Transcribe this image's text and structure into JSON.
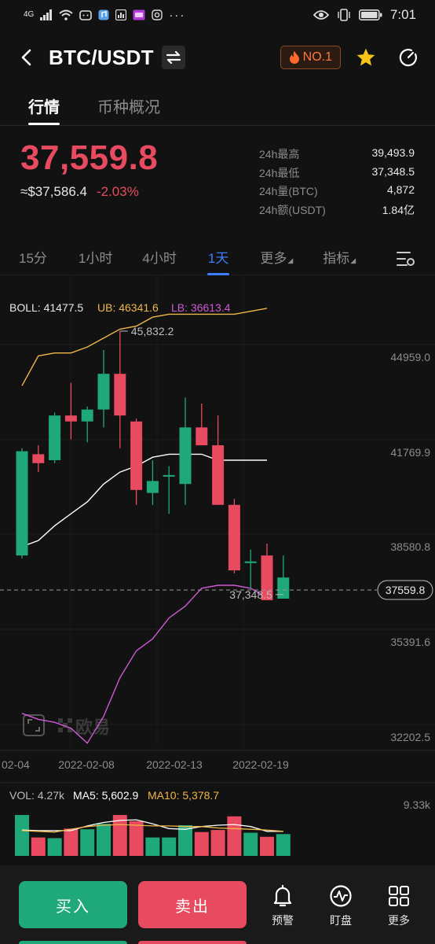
{
  "status_bar": {
    "network": "4G",
    "time": "7:01"
  },
  "header": {
    "pair": "BTC/USDT",
    "rank": "NO.1"
  },
  "tabs": [
    {
      "label": "行情",
      "active": true
    },
    {
      "label": "币种概况",
      "active": false
    }
  ],
  "price": {
    "last": "37,559.8",
    "usd": "≈$37,586.4",
    "change": "-2.03%"
  },
  "stats": [
    {
      "label": "24h最高",
      "value": "39,493.9"
    },
    {
      "label": "24h最低",
      "value": "37,348.5"
    },
    {
      "label": "24h量(BTC)",
      "value": "4,872"
    },
    {
      "label": "24h额(USDT)",
      "value": "1.84亿"
    }
  ],
  "intervals": [
    {
      "label": "15分",
      "active": false
    },
    {
      "label": "1小时",
      "active": false
    },
    {
      "label": "4小时",
      "active": false
    },
    {
      "label": "1天",
      "active": true
    },
    {
      "label": "更多",
      "active": false
    },
    {
      "label": "指标",
      "active": false
    }
  ],
  "indicators": {
    "boll": {
      "label": "BOLL: 41477.5",
      "ub": "UB: 46341.6",
      "lb": "LB: 36613.4"
    },
    "vol": {
      "label": "VOL: 4.27k",
      "ma5": "MA5: 5,602.9",
      "ma10": "MA10: 5,378.7"
    }
  },
  "watermark": "欧易",
  "colors": {
    "up": "#1fa97b",
    "down": "#e84a5f",
    "ub": "#f0b64a",
    "lb": "#d05ad6",
    "mid": "#ffffff",
    "accent": "#3d7eff",
    "rank": "#ff7a3a"
  },
  "chart_data": {
    "type": "candlestick",
    "y_axis_ticks": [
      "44959.0",
      "41769.9",
      "38580.8",
      "35391.6",
      "32202.5"
    ],
    "x_axis_ticks": [
      "02-04",
      "2022-02-08",
      "2022-02-13",
      "2022-02-19"
    ],
    "annotations": {
      "high": "45,832.2",
      "low": "37,348.5",
      "current": "37559.8"
    },
    "volume_axis_max_label": "9.33k",
    "candles": [
      {
        "o": 38300,
        "h": 41900,
        "l": 38200,
        "c": 41800
      },
      {
        "o": 41700,
        "h": 42000,
        "l": 41100,
        "c": 41400
      },
      {
        "o": 41500,
        "h": 43100,
        "l": 41400,
        "c": 43000
      },
      {
        "o": 43000,
        "h": 44100,
        "l": 42200,
        "c": 42800
      },
      {
        "o": 42800,
        "h": 43300,
        "l": 42100,
        "c": 43200
      },
      {
        "o": 43200,
        "h": 45200,
        "l": 42600,
        "c": 44400
      },
      {
        "o": 44400,
        "h": 45832.2,
        "l": 41900,
        "c": 43000
      },
      {
        "o": 42800,
        "h": 42900,
        "l": 40000,
        "c": 40500
      },
      {
        "o": 40400,
        "h": 41500,
        "l": 40000,
        "c": 40800
      },
      {
        "o": 41000,
        "h": 41300,
        "l": 39700,
        "c": 41000
      },
      {
        "o": 40700,
        "h": 43600,
        "l": 40000,
        "c": 42600
      },
      {
        "o": 42600,
        "h": 43400,
        "l": 42000,
        "c": 42000
      },
      {
        "o": 42000,
        "h": 43000,
        "l": 40000,
        "c": 40000
      },
      {
        "o": 40000,
        "h": 40200,
        "l": 37700,
        "c": 37800
      },
      {
        "o": 38100,
        "h": 38500,
        "l": 37200,
        "c": 38100
      },
      {
        "o": 38300,
        "h": 38700,
        "l": 36800,
        "c": 36800
      },
      {
        "o": 36850,
        "h": 38300,
        "l": 37200,
        "c": 37559.8
      }
    ],
    "boll_ub": [
      44000,
      45000,
      45100,
      45100,
      45300,
      45600,
      45900,
      46000,
      46300,
      46400,
      46400,
      46400,
      46400,
      46400,
      46500,
      46600
    ],
    "boll_mid": [
      38600,
      38800,
      39300,
      39700,
      40100,
      40700,
      41100,
      41300,
      41600,
      41700,
      41700,
      41700,
      41500,
      41500,
      41500,
      41500
    ],
    "boll_lb": [
      33000,
      32800,
      32700,
      32500,
      32000,
      32900,
      34200,
      35100,
      35500,
      36200,
      36600,
      37200,
      37300,
      37300,
      37200,
      36900
    ],
    "volumes": [
      6000,
      2700,
      2600,
      4000,
      3900,
      4700,
      6000,
      5100,
      2700,
      2700,
      4500,
      3500,
      3800,
      5800,
      3400,
      2800,
      3200
    ],
    "ma5": [
      3800,
      3700,
      3700,
      3700,
      4400,
      4900,
      5200,
      5300,
      4700,
      4000,
      3900,
      4300,
      4500,
      4600,
      4300,
      3600,
      3600
    ],
    "ma10": [
      3700,
      3600,
      3500,
      3900,
      4300,
      4500,
      4600,
      4500,
      4400,
      4400,
      4300,
      4300,
      4100,
      4000,
      3900,
      3800,
      3600
    ]
  }
}
